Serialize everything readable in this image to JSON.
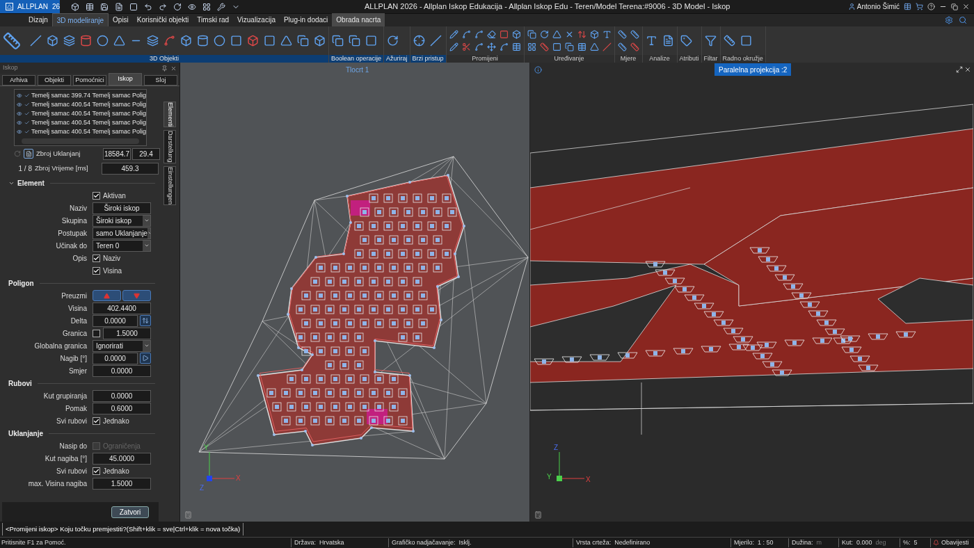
{
  "title_bar": {
    "logo": "ALLPLAN",
    "version": "26",
    "title": "ALLPLAN 2026 - Allplan Iskop Edukacija - Allplan Iskop Edu - Teren/Model Terena:#9006 - 3D Model - Iskop",
    "user": "Antonio Šimić"
  },
  "ribbon_tabs": [
    {
      "label": "Dizajn",
      "selected": false,
      "contextual": false
    },
    {
      "label": "3D modeliranje",
      "selected": true,
      "contextual": false
    },
    {
      "label": "Opisi",
      "selected": false,
      "contextual": false
    },
    {
      "label": "Korisnički objekti",
      "selected": false,
      "contextual": false
    },
    {
      "label": "Timski rad",
      "selected": false,
      "contextual": false
    },
    {
      "label": "Vizualizacija",
      "selected": false,
      "contextual": false
    },
    {
      "label": "Plug-in dodaci",
      "selected": false,
      "contextual": false
    },
    {
      "label": "Obrada nacrta",
      "selected": false,
      "contextual": true
    }
  ],
  "ribbon_groups": [
    {
      "label": "3D Objekti",
      "active": true
    },
    {
      "label": "Boolean operacije",
      "active": true
    },
    {
      "label": "Ažuriraj",
      "active": true
    },
    {
      "label": "Brzi pristup",
      "active": true
    },
    {
      "label": "Promijeni",
      "active": false
    },
    {
      "label": "Uređivanje",
      "active": false
    },
    {
      "label": "Mjere",
      "active": false
    },
    {
      "label": "Analize",
      "active": false
    },
    {
      "label": "Atributi",
      "active": false
    },
    {
      "label": "Filtar",
      "active": false
    },
    {
      "label": "Radno okružje",
      "active": false
    }
  ],
  "panel": {
    "title": "Iskop",
    "tabs": [
      {
        "label": "Arhiva",
        "selected": false
      },
      {
        "label": "Objekti",
        "selected": false
      },
      {
        "label": "Pomoćnici",
        "selected": false
      },
      {
        "label": "Iskop",
        "selected": true
      },
      {
        "label": "Sloj",
        "selected": false
      }
    ],
    "side_tabs": [
      {
        "label": "Elementi",
        "selected": true
      },
      {
        "label": "Darstellung",
        "selected": false
      },
      {
        "label": "Einstellungen",
        "selected": false
      }
    ],
    "list": [
      {
        "text": "Temelj samac 399.74 Temelj samac Polig",
        "visible": true,
        "checked": true
      },
      {
        "text": "Temelj samac 400.54 Temelj samac Polig",
        "visible": true,
        "checked": true
      },
      {
        "text": "Temelj samac 400.54 Temelj samac Polig",
        "visible": true,
        "checked": true
      },
      {
        "text": "Temelj samac 400.54 Temelj samac Polig",
        "visible": true,
        "checked": true
      },
      {
        "text": "Temelj samac 400.54 Temelj samac Polig",
        "visible": true,
        "checked": true
      }
    ],
    "summary": [
      {
        "label": "Zbroj Uklanjanj",
        "values": [
          "18584.7",
          "29.4"
        ]
      },
      {
        "index": "1 / 8",
        "label": "Zbroj Vrijeme [ms]",
        "values": [
          "459.3"
        ]
      }
    ],
    "sections": [
      {
        "title": "Element",
        "expandable": true,
        "rows": [
          {
            "kind": "check",
            "text": "Aktivan",
            "checked": true,
            "disabled": false
          },
          {
            "kind": "input",
            "label": "Naziv",
            "value": "Široki iskop"
          },
          {
            "kind": "select",
            "label": "Skupina",
            "value": "Široki iskop"
          },
          {
            "kind": "select",
            "label": "Postupak",
            "value": "samo Uklanjanje"
          },
          {
            "kind": "select",
            "label": "Učinak do",
            "value": "Teren 0"
          },
          {
            "kind": "check",
            "label": "Opis",
            "text": "Naziv",
            "checked": true,
            "disabled": false
          },
          {
            "kind": "check",
            "text": "Visina",
            "checked": true,
            "disabled": false
          }
        ]
      },
      {
        "title": "Poligon",
        "expandable": false,
        "rows": [
          {
            "kind": "buttons",
            "label": "Preuzmi"
          },
          {
            "kind": "input",
            "label": "Visina",
            "value": "402.4400"
          },
          {
            "kind": "input_button",
            "label": "Delta",
            "value": "0.0000"
          },
          {
            "kind": "check_input",
            "label": "Granica",
            "checked": false,
            "value": "1.5000"
          },
          {
            "kind": "select",
            "label": "Globalna granica",
            "value": "Ignorirati"
          },
          {
            "kind": "input_button",
            "label": "Nagib [°]",
            "value": "0.0000"
          },
          {
            "kind": "input",
            "label": "Smjer",
            "value": "0.0000"
          }
        ]
      },
      {
        "title": "Rubovi",
        "expandable": false,
        "rows": [
          {
            "kind": "input",
            "label": "Kut grupiranja",
            "value": "0.0000"
          },
          {
            "kind": "input",
            "label": "Pomak",
            "value": "0.6000"
          },
          {
            "kind": "check",
            "label": "Svi rubovi",
            "text": "Jednako",
            "checked": true,
            "disabled": false
          }
        ]
      },
      {
        "title": "Uklanjanje",
        "expandable": false,
        "rows": [
          {
            "kind": "check",
            "label": "Nasip do",
            "text": "Ograničenja",
            "checked": false,
            "disabled": true
          },
          {
            "kind": "input",
            "label": "Kut nagiba [°]",
            "value": "45.0000"
          },
          {
            "kind": "check",
            "label": "Svi rubovi",
            "text": "Jednako",
            "checked": true,
            "disabled": false
          },
          {
            "kind": "input",
            "label": "max. Visina nagiba",
            "value": "1.5000"
          }
        ]
      }
    ],
    "close_button": "Zatvori"
  },
  "viewports": [
    {
      "title": "Tlocrt 1",
      "kind": "plan",
      "axes": [
        "Y",
        "X",
        "Z"
      ]
    },
    {
      "title": "Paralelna projekcija :2",
      "kind": "model",
      "axes": [
        "Z",
        "Y",
        "X"
      ]
    }
  ],
  "command_line": "<Promijeni iskop> Koju točku premjestiti?(Shift+klik = sve|Ctrl+klik = nova točka)",
  "status_bar": {
    "help": "Pritisnite F1 za Pomoć.",
    "items": [
      {
        "label": "Država:",
        "value": "Hrvatska"
      },
      {
        "label": "Grafičko nadjačavanje:",
        "value": "Isklj."
      },
      {
        "label": "Vrsta crteža:",
        "value": "Nedefinirano"
      },
      {
        "label": "Mjerilo:",
        "value": "1 : 50"
      },
      {
        "label": "Dužina:",
        "unit": "m"
      },
      {
        "label": "Kut:",
        "value": "0.000",
        "unit": "deg"
      },
      {
        "label": "%:",
        "value": "5"
      }
    ],
    "notifications": "Obavijesti"
  }
}
